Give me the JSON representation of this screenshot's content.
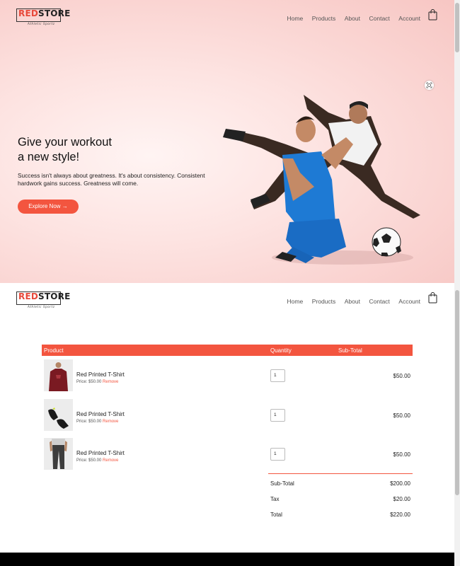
{
  "brand": {
    "red": "RED",
    "black": "STORE",
    "tagline": "Athletic Sportz"
  },
  "nav": [
    "Home",
    "Products",
    "About",
    "Contact",
    "Account"
  ],
  "hero": {
    "title_line1": "Give your workout",
    "title_line2": "a new style!",
    "text": "Success isn't always about greatness. It's about consistency. Consistent hardwork gains success. Greatness will come.",
    "button": "Explore Now →"
  },
  "cart": {
    "headers": {
      "product": "Product",
      "quantity": "Quantity",
      "subtotal": "Sub-Total"
    },
    "items": [
      {
        "name": "Red Printed T-Shirt",
        "price": "Price: $50.00",
        "remove": "Remove",
        "qty": "1",
        "subtotal": "$50.00",
        "image": "red-tshirt"
      },
      {
        "name": "Red Printed T-Shirt",
        "price": "Price: $50.00",
        "remove": "Remove",
        "qty": "1",
        "subtotal": "$50.00",
        "image": "black-shoes"
      },
      {
        "name": "Red Printed T-Shirt",
        "price": "Price: $50.00",
        "remove": "Remove",
        "qty": "1",
        "subtotal": "$50.00",
        "image": "grey-pants"
      }
    ],
    "totals": [
      {
        "label": "Sub-Total",
        "value": "$200.00"
      },
      {
        "label": "Tax",
        "value": "$20.00"
      },
      {
        "label": "Total",
        "value": "$220.00"
      }
    ]
  },
  "colors": {
    "accent": "#f3553f",
    "hero_bg": "#fbd4d1"
  }
}
